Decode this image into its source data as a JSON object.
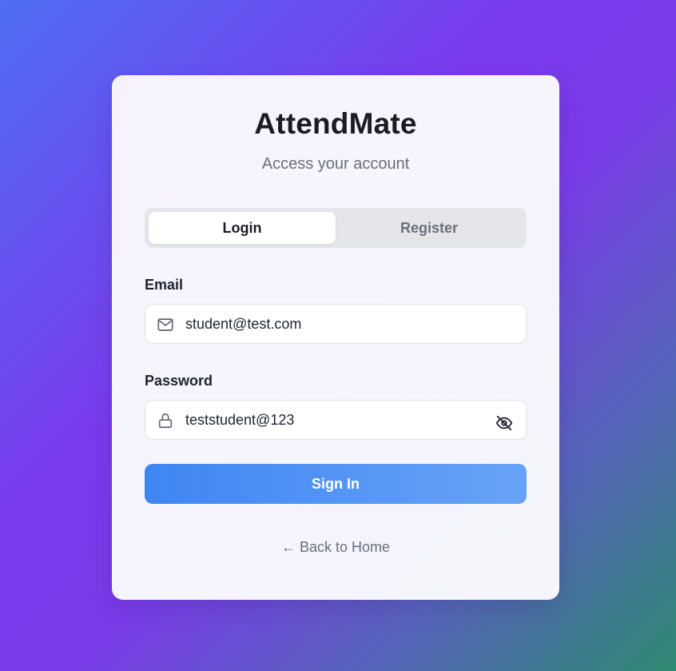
{
  "app": {
    "title": "AttendMate",
    "subtitle": "Access your account"
  },
  "tabs": [
    {
      "label": "Login",
      "active": true
    },
    {
      "label": "Register",
      "active": false
    }
  ],
  "form": {
    "email": {
      "label": "Email",
      "value": "student@test.com",
      "icon": "mail-icon"
    },
    "password": {
      "label": "Password",
      "value": "teststudent@123",
      "icon": "lock-icon",
      "toggle_icon": "eye-off-icon"
    },
    "submit_label": "Sign In"
  },
  "footer": {
    "back_link": "← Back to Home"
  },
  "colors": {
    "primary": "#3f86f2",
    "primary_light": "#67a3f7",
    "text_dark": "#1b1b22",
    "text_muted": "#6b6f7a",
    "tab_track": "#e5e6ea"
  }
}
